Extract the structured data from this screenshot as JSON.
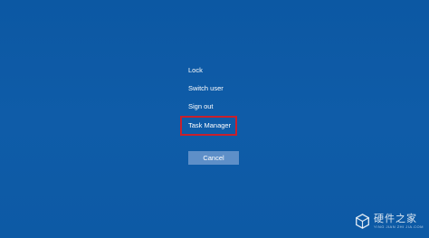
{
  "security_screen": {
    "items": [
      {
        "label": "Lock"
      },
      {
        "label": "Switch user"
      },
      {
        "label": "Sign out"
      },
      {
        "label": "Task Manager"
      }
    ],
    "cancel_label": "Cancel"
  },
  "watermark": {
    "main": "硬件之家",
    "sub": "YING JIAN ZHI JIA.COM",
    "icon": "cube-logo-icon"
  },
  "colors": {
    "background": "#0f5ba6",
    "highlight": "#c8202c",
    "button": "#5e8fc8"
  }
}
